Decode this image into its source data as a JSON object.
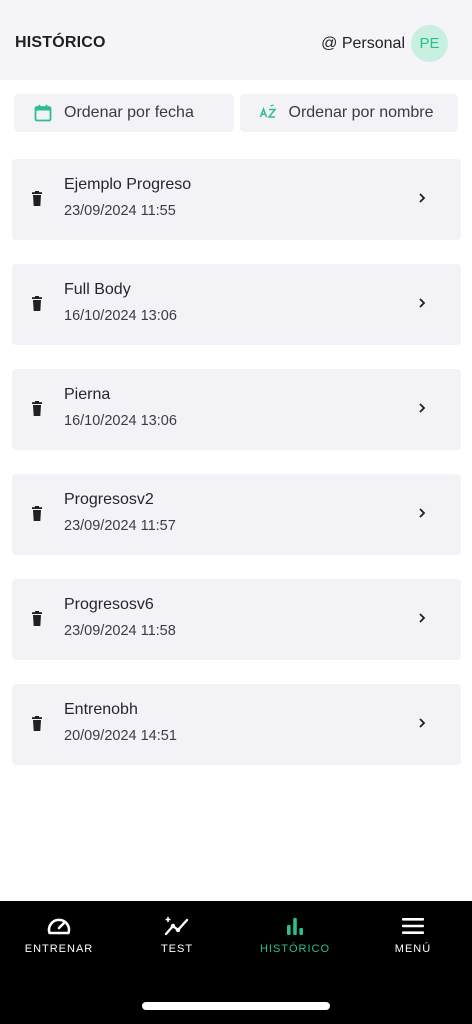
{
  "header": {
    "title": "HISTÓRICO",
    "account_name": "@ Personal",
    "avatar_initials": "PE",
    "avatar_bg": "#c8efe0",
    "avatar_fg": "#2bbf8f"
  },
  "sort": {
    "by_date_label": "Ordenar por fecha",
    "by_name_label": "Ordenar por nombre",
    "icon_color": "#2bbf8f"
  },
  "workouts": [
    {
      "title": "Ejemplo Progreso",
      "date": "23/09/2024 11:55"
    },
    {
      "title": "Full Body",
      "date": "16/10/2024 13:06"
    },
    {
      "title": "Pierna",
      "date": "16/10/2024 13:06"
    },
    {
      "title": "Progresosv2",
      "date": "23/09/2024 11:57"
    },
    {
      "title": "Progresosv6",
      "date": "23/09/2024 11:58"
    },
    {
      "title": "Entrenobh",
      "date": "20/09/2024 14:51"
    }
  ],
  "nav": {
    "items": [
      {
        "label": "ENTRENAR",
        "icon": "speedometer-icon"
      },
      {
        "label": "TEST",
        "icon": "trend-chart-icon"
      },
      {
        "label": "HISTÓRICO",
        "icon": "bar-chart-icon"
      },
      {
        "label": "MENÚ",
        "icon": "menu-icon"
      }
    ],
    "active_index": 2,
    "active_color": "#2bbf8f",
    "inactive_color": "#ffffff"
  }
}
